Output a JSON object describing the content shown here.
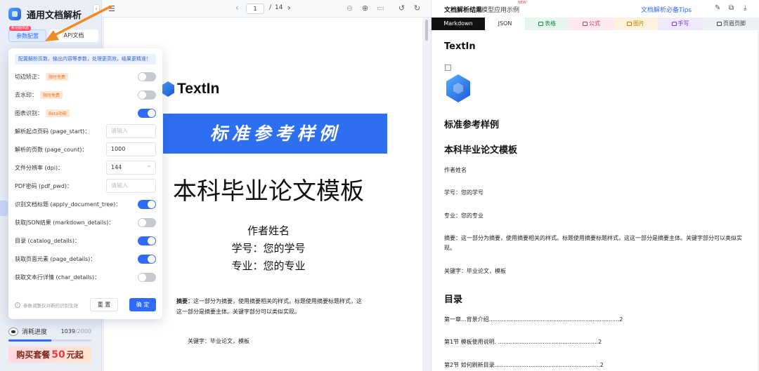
{
  "app": {
    "title": "通用文档解析",
    "collapse_glyph": "‹"
  },
  "sidebar": {
    "tabs": [
      {
        "label": "参数配置",
        "badge": "新功能体验",
        "active": true
      },
      {
        "label": "API文档",
        "active": false
      }
    ],
    "usage": {
      "label": "消耗进度",
      "used": "1039",
      "total": "/2000",
      "fraction": 0.52
    },
    "buy": {
      "prefix": "购买套餐",
      "amount": "50",
      "suffix": "元起"
    }
  },
  "settings": {
    "note": "配置解析页数、输出内容等参数，处理更高效，结果更精准！",
    "options": [
      {
        "label": "切边矫正：",
        "tag": "限时免费",
        "type": "toggle",
        "on": false
      },
      {
        "label": "去水印：",
        "tag": "限时免费",
        "type": "toggle",
        "on": false
      },
      {
        "label": "图表识别：",
        "tag": "Beta功能",
        "type": "toggle",
        "on": true
      },
      {
        "label": "解析起点页码 (page_start)：",
        "type": "input",
        "value": "",
        "placeholder": "请输入"
      },
      {
        "label": "解析的页数 (page_count)：",
        "type": "input",
        "value": "1000",
        "placeholder": ""
      },
      {
        "label": "文件分辨率 (dpi)：",
        "type": "select",
        "value": "144"
      },
      {
        "label": "PDF密码 (pdf_pwd)：",
        "type": "input",
        "value": "",
        "placeholder": "请输入"
      },
      {
        "label": "识别文档标题 (apply_document_tree)：",
        "type": "toggle",
        "on": true
      },
      {
        "label": "获取JSON结果 (markdown_details)：",
        "type": "toggle",
        "on": false
      },
      {
        "label": "目录 (catalog_details)：",
        "type": "toggle",
        "on": true
      },
      {
        "label": "获取页面元素 (page_details)：",
        "type": "toggle",
        "on": true
      },
      {
        "label": "获取文本行详情 (char_details)：",
        "type": "toggle",
        "on": false
      }
    ],
    "footer_note": "参数调整仅对新的识别生效",
    "reset_label": "重 置",
    "ok_label": "确 定"
  },
  "viewer": {
    "page_current": "1",
    "page_separator": "/",
    "page_total": "14",
    "doc": {
      "logo_text": "TextIn",
      "banner": "标准参考样例",
      "title": "本科毕业论文模板",
      "author": "作者姓名",
      "student_id": "学号：您的学号",
      "major": "专业：您的专业",
      "abstract_label": "摘要：",
      "abstract_text": "这一部分为摘要，使用摘要相关的样式。标题使用摘要标题样式，这这一部分是摘要主体。关键字部分可以类似实现。",
      "keywords": "关键字：毕业论文，模板"
    }
  },
  "result": {
    "title": "文档解析结果",
    "demo": "大模型应用示例",
    "new_badge": "NEW",
    "tips": "文档解析必备Tips",
    "tabs": [
      "Markdown",
      "JSON",
      "表格",
      "公式",
      "图片",
      "手写",
      "页眉页脚"
    ],
    "content": {
      "heading": "TextIn",
      "h_sample": "标准参考样例",
      "h_title": "本科毕业论文模板",
      "author": "作者姓名",
      "student_id": "学号：您的学号",
      "major": "专业：您的专业",
      "abstract": "摘要：这一部分为摘要，使用摘要相关的样式。标题使用摘要标题样式，这这一部分是摘要主体。关键字部分可以类似实现。",
      "keywords": "关键字：毕业论文，模板",
      "toc_heading": "目录",
      "toc": [
        "第一章...背景介绍.........................................................................2",
        "第1节  模板使用说明.  ........................................................2",
        "第2节  如何刷新目录...........................................................2"
      ]
    }
  },
  "colors": {
    "accent": "#2f6bff",
    "banner_blue": "#2e6ff2",
    "arrow_orange": "#f08a24"
  }
}
